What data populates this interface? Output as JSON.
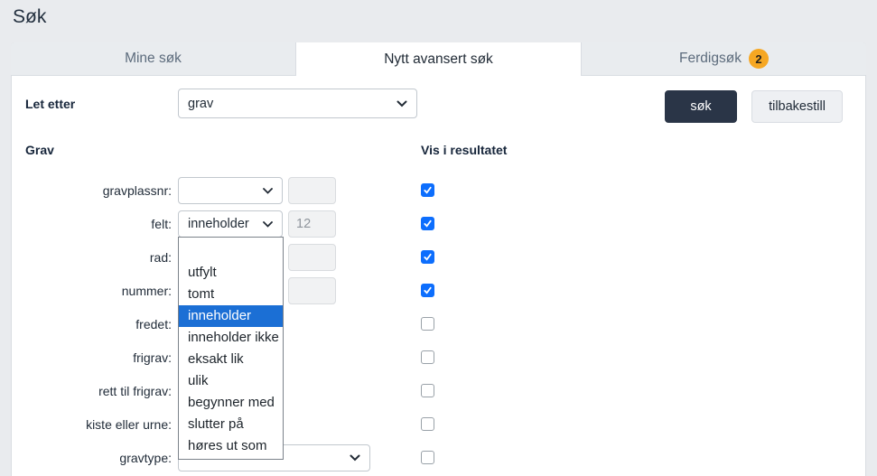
{
  "page": {
    "title": "Søk"
  },
  "tabs": [
    {
      "label": "Mine søk"
    },
    {
      "label": "Nytt avansert søk"
    },
    {
      "label": "Ferdigsøk",
      "badge": "2"
    }
  ],
  "search_controls": {
    "let_etter_label": "Let etter",
    "let_etter_value": "grav",
    "sok_button": "søk",
    "reset_button": "tilbakestill"
  },
  "section": {
    "title": "Grav",
    "results_column": "Vis i resultatet"
  },
  "form": {
    "rows": [
      {
        "label": "gravplassnr:",
        "operator": "",
        "value": "",
        "checked": true
      },
      {
        "label": "felt:",
        "operator": "inneholder",
        "value": "12",
        "checked": true
      },
      {
        "label": "rad:",
        "value": "",
        "checked": true
      },
      {
        "label": "nummer:",
        "value": "",
        "checked": true
      },
      {
        "label": "fredet:",
        "checked": false
      },
      {
        "label": "frigrav:",
        "checked": false
      },
      {
        "label": "rett til frigrav:",
        "checked": false
      },
      {
        "label": "kiste eller urne:",
        "checked": false
      },
      {
        "label": "gravtype:",
        "operator": "",
        "checked": false
      }
    ]
  },
  "operator_dropdown": {
    "options": [
      "",
      "utfylt",
      "tomt",
      "inneholder",
      "inneholder ikke",
      "eksakt lik",
      "ulik",
      "begynner med",
      "slutter på",
      "høres ut som"
    ],
    "selected": "inneholder"
  },
  "colors": {
    "accent_blue": "#0d6efd",
    "highlight_blue": "#1b6fd5",
    "badge_orange": "#f6a723",
    "dark_button": "#2a3547",
    "page_background": "#e9ebee"
  }
}
